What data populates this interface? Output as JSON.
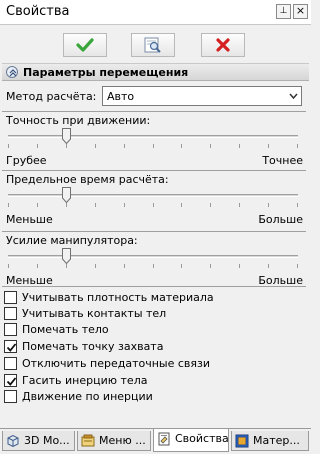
{
  "window": {
    "title": "Свойства",
    "pin_glyph": "⊥",
    "close_glyph": "×"
  },
  "toolbar": {
    "ok_icon": "checkmark-icon",
    "preview_icon": "preview-icon",
    "cancel_icon": "cross-icon",
    "colors": {
      "ok": "#3aa53a",
      "cancel": "#d42020"
    }
  },
  "section": {
    "title": "Параметры перемещения",
    "collapse_icon": "chevron-up-icon"
  },
  "method": {
    "label": "Метод расчёта:",
    "value": "Авто"
  },
  "sliders": [
    {
      "title": "Точность при движении:",
      "min_label": "Грубее",
      "max_label": "Точнее",
      "level": 0.2
    },
    {
      "title": "Предельное время расчёта:",
      "min_label": "Меньше",
      "max_label": "Больше",
      "level": 0.2
    },
    {
      "title": "Усилие манипулятора:",
      "min_label": "Меньше",
      "max_label": "Больше",
      "level": 0.2
    }
  ],
  "options": [
    {
      "label": "Учитывать плотность материала",
      "checked": false
    },
    {
      "label": "Учитывать контакты тел",
      "checked": false
    },
    {
      "label": "Помечать тело",
      "checked": false
    },
    {
      "label": "Помечать точку захвата",
      "checked": true
    },
    {
      "label": "Отключить передаточные связи",
      "checked": false
    },
    {
      "label": "Гасить инерцию тела",
      "checked": true
    },
    {
      "label": "Движение по инерции",
      "checked": false
    }
  ],
  "tabs": [
    {
      "label": "3D Мо...",
      "icon": "3d-model-icon",
      "active": false
    },
    {
      "label": "Меню ...",
      "icon": "menu-icon",
      "active": false
    },
    {
      "label": "Свойства",
      "icon": "properties-icon",
      "active": true
    },
    {
      "label": "Матер...",
      "icon": "materials-icon",
      "active": false
    }
  ]
}
